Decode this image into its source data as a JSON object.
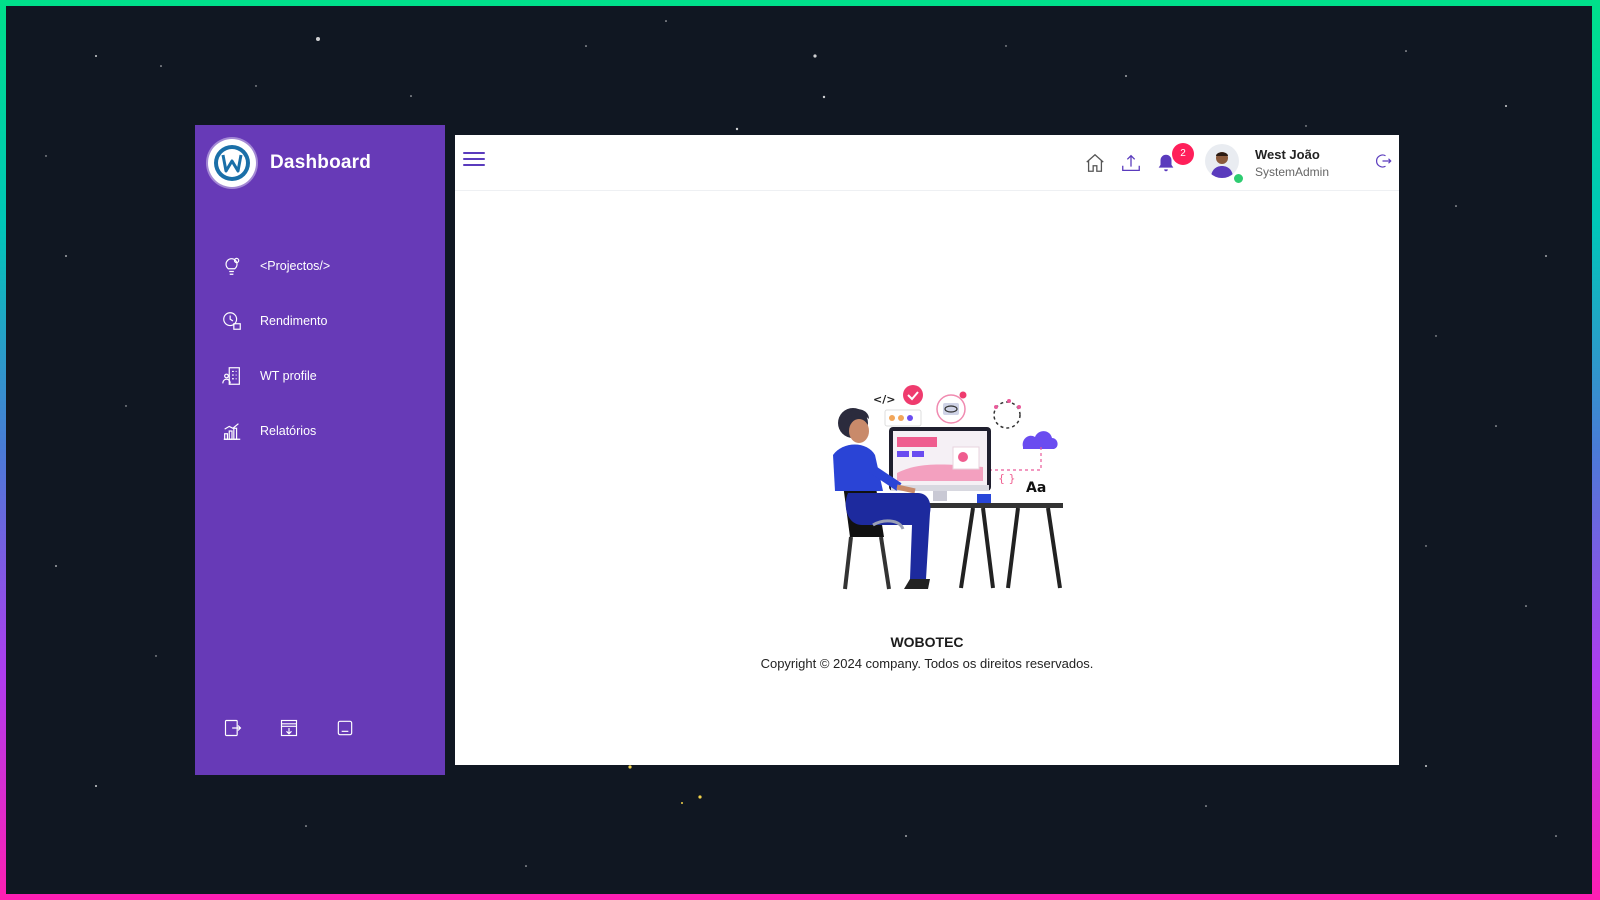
{
  "brand": {
    "title": "Dashboard",
    "logo_letter": "W"
  },
  "sidebar": {
    "items": [
      {
        "label": "<Projectos/>",
        "icon": "lightbulb-gear-icon"
      },
      {
        "label": "Rendimento",
        "icon": "performance-icon"
      },
      {
        "label": "WT profile",
        "icon": "building-profile-icon"
      },
      {
        "label": "Relatórios",
        "icon": "bar-chart-icon"
      }
    ],
    "bottom_icons": [
      "exit-icon",
      "download-doc-icon",
      "minimize-icon"
    ]
  },
  "header": {
    "notification_count": "2",
    "user": {
      "name": "West João",
      "role": "SystemAdmin"
    },
    "icons": [
      "menu-icon",
      "home-icon",
      "upload-icon",
      "bell-icon",
      "logout-icon"
    ]
  },
  "illustration": {
    "text_code": "</>",
    "text_braces": "{ }",
    "text_aa": "Aa"
  },
  "footer": {
    "company": "WOBOTEC",
    "copyright": "Copyright ©  2024 company. Todos os direitos reservados."
  },
  "colors": {
    "sidebar": "#673ab7",
    "accent": "#5a3bbd",
    "badge": "#ff1f5a",
    "background": "#101722"
  }
}
